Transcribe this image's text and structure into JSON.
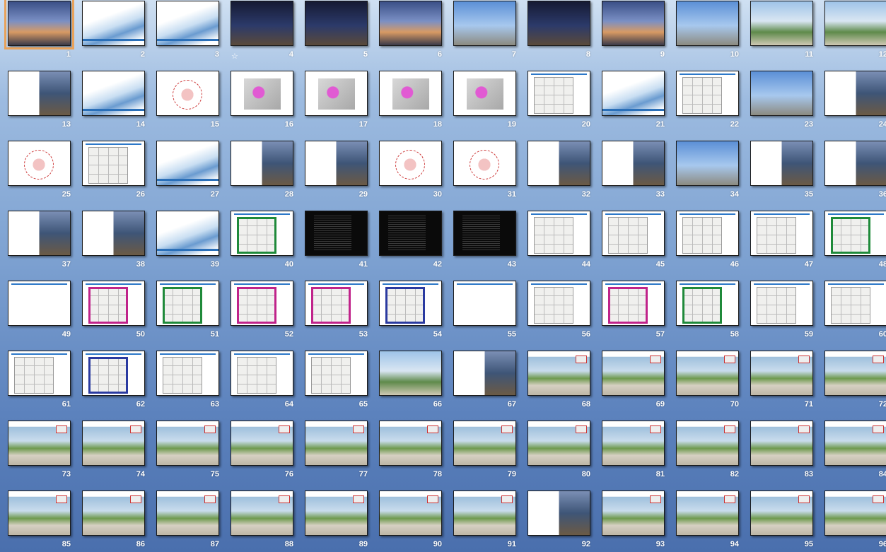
{
  "app": {
    "view": "slide-sorter"
  },
  "slides": [
    {
      "number": "1",
      "style": "t-photo-dusk",
      "selected": true
    },
    {
      "number": "2",
      "style": "t-cover"
    },
    {
      "number": "3",
      "style": "t-cover"
    },
    {
      "number": "4",
      "style": "t-photo-night",
      "animation_icon": "☆"
    },
    {
      "number": "5",
      "style": "t-photo-night"
    },
    {
      "number": "6",
      "style": "t-photo-dusk"
    },
    {
      "number": "7",
      "style": "t-photo-day"
    },
    {
      "number": "8",
      "style": "t-photo-night"
    },
    {
      "number": "9",
      "style": "t-photo-dusk"
    },
    {
      "number": "10",
      "style": "t-photo-day"
    },
    {
      "number": "11",
      "style": "t-photo-green"
    },
    {
      "number": "12",
      "style": "t-photo-green"
    },
    {
      "number": "13",
      "style": "t-collage"
    },
    {
      "number": "14",
      "style": "t-cover"
    },
    {
      "number": "15",
      "style": "t-diagram"
    },
    {
      "number": "16",
      "style": "t-map"
    },
    {
      "number": "17",
      "style": "t-map"
    },
    {
      "number": "18",
      "style": "t-map"
    },
    {
      "number": "19",
      "style": "t-map"
    },
    {
      "number": "20",
      "style": "t-plan"
    },
    {
      "number": "21",
      "style": "t-cover"
    },
    {
      "number": "22",
      "style": "t-plan"
    },
    {
      "number": "23",
      "style": "t-photo-day"
    },
    {
      "number": "24",
      "style": "t-collage"
    },
    {
      "number": "25",
      "style": "t-diagram"
    },
    {
      "number": "26",
      "style": "t-plan"
    },
    {
      "number": "27",
      "style": "t-cover"
    },
    {
      "number": "28",
      "style": "t-collage"
    },
    {
      "number": "29",
      "style": "t-collage"
    },
    {
      "number": "30",
      "style": "t-diagram"
    },
    {
      "number": "31",
      "style": "t-diagram"
    },
    {
      "number": "32",
      "style": "t-collage"
    },
    {
      "number": "33",
      "style": "t-collage"
    },
    {
      "number": "34",
      "style": "t-photo-day"
    },
    {
      "number": "35",
      "style": "t-collage"
    },
    {
      "number": "36",
      "style": "t-collage"
    },
    {
      "number": "37",
      "style": "t-collage"
    },
    {
      "number": "38",
      "style": "t-collage"
    },
    {
      "number": "39",
      "style": "t-cover"
    },
    {
      "number": "40",
      "style": "t-plan t-plan-green"
    },
    {
      "number": "41",
      "style": "t-dark"
    },
    {
      "number": "42",
      "style": "t-dark"
    },
    {
      "number": "43",
      "style": "t-dark"
    },
    {
      "number": "44",
      "style": "t-plan"
    },
    {
      "number": "45",
      "style": "t-plan"
    },
    {
      "number": "46",
      "style": "t-plan"
    },
    {
      "number": "47",
      "style": "t-plan"
    },
    {
      "number": "48",
      "style": "t-plan t-plan-green"
    },
    {
      "number": "49",
      "style": "t-blank"
    },
    {
      "number": "50",
      "style": "t-plan t-plan-magenta"
    },
    {
      "number": "51",
      "style": "t-plan t-plan-green"
    },
    {
      "number": "52",
      "style": "t-plan t-plan-magenta"
    },
    {
      "number": "53",
      "style": "t-plan t-plan-magenta"
    },
    {
      "number": "54",
      "style": "t-plan t-plan-blue"
    },
    {
      "number": "55",
      "style": "t-blank"
    },
    {
      "number": "56",
      "style": "t-plan"
    },
    {
      "number": "57",
      "style": "t-plan t-plan-magenta"
    },
    {
      "number": "58",
      "style": "t-plan t-plan-green"
    },
    {
      "number": "59",
      "style": "t-plan"
    },
    {
      "number": "60",
      "style": "t-plan"
    },
    {
      "number": "61",
      "style": "t-plan"
    },
    {
      "number": "62",
      "style": "t-plan t-plan-blue"
    },
    {
      "number": "63",
      "style": "t-plan"
    },
    {
      "number": "64",
      "style": "t-plan"
    },
    {
      "number": "65",
      "style": "t-plan"
    },
    {
      "number": "66",
      "style": "t-photo-green"
    },
    {
      "number": "67",
      "style": "t-collage"
    },
    {
      "number": "68",
      "style": "t-street"
    },
    {
      "number": "69",
      "style": "t-street"
    },
    {
      "number": "70",
      "style": "t-street"
    },
    {
      "number": "71",
      "style": "t-street"
    },
    {
      "number": "72",
      "style": "t-street"
    },
    {
      "number": "73",
      "style": "t-street"
    },
    {
      "number": "74",
      "style": "t-street"
    },
    {
      "number": "75",
      "style": "t-street"
    },
    {
      "number": "76",
      "style": "t-street"
    },
    {
      "number": "77",
      "style": "t-street"
    },
    {
      "number": "78",
      "style": "t-street"
    },
    {
      "number": "79",
      "style": "t-street"
    },
    {
      "number": "80",
      "style": "t-street"
    },
    {
      "number": "81",
      "style": "t-street"
    },
    {
      "number": "82",
      "style": "t-street"
    },
    {
      "number": "83",
      "style": "t-street"
    },
    {
      "number": "84",
      "style": "t-street"
    },
    {
      "number": "85",
      "style": "t-street"
    },
    {
      "number": "86",
      "style": "t-street"
    },
    {
      "number": "87",
      "style": "t-street"
    },
    {
      "number": "88",
      "style": "t-street"
    },
    {
      "number": "89",
      "style": "t-street"
    },
    {
      "number": "90",
      "style": "t-street"
    },
    {
      "number": "91",
      "style": "t-street"
    },
    {
      "number": "92",
      "style": "t-collage"
    },
    {
      "number": "93",
      "style": "t-street"
    },
    {
      "number": "94",
      "style": "t-street"
    },
    {
      "number": "95",
      "style": "t-street"
    },
    {
      "number": "96",
      "style": "t-street"
    }
  ],
  "colors": {
    "selection": "#e8a25b",
    "slide_number_text": "#ffffff",
    "background_top": "#cfe0f2",
    "background_bottom": "#4a6fad"
  }
}
